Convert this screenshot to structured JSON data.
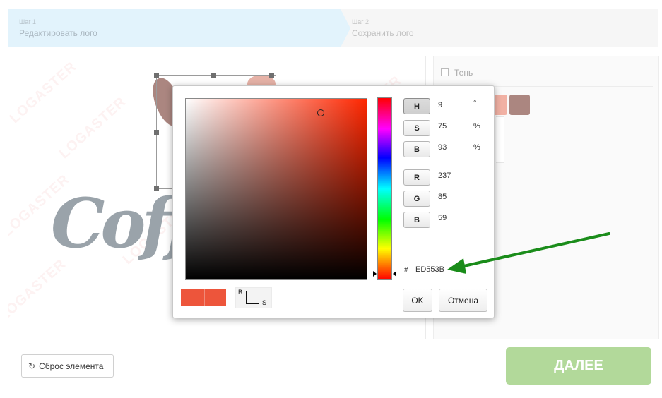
{
  "steps": [
    {
      "num": "Шаг 1",
      "label": "Редактировать лого"
    },
    {
      "num": "Шаг 2",
      "label": "Сохранить лого"
    }
  ],
  "canvas": {
    "watermark": "LOGASTER",
    "logo_text": "Coff"
  },
  "right_panel": {
    "shadow_label": "Тень",
    "swatches": [
      "#f1b1a4",
      "#ab8680"
    ]
  },
  "color_picker": {
    "modes": [
      {
        "key": "H",
        "value": "9",
        "unit": "°"
      },
      {
        "key": "S",
        "value": "75",
        "unit": "%"
      },
      {
        "key": "B",
        "value": "93",
        "unit": "%"
      },
      {
        "key": "R",
        "value": "237",
        "unit": ""
      },
      {
        "key": "G",
        "value": "85",
        "unit": ""
      },
      {
        "key": "B",
        "value": "59",
        "unit": ""
      }
    ],
    "hex_prefix": "#",
    "hex": "ED553B",
    "current_color": "#ed553b",
    "axis_vertical": "B",
    "axis_horizontal": "S",
    "ok_label": "OK",
    "cancel_label": "Отмена"
  },
  "buttons": {
    "reset_label": "Сброс элемента",
    "next_label": "ДАЛЕЕ"
  },
  "colors": {
    "step_active": "#e2f3fc",
    "next_button": "#b2d99a",
    "annotation_arrow": "#1a8c1a"
  }
}
